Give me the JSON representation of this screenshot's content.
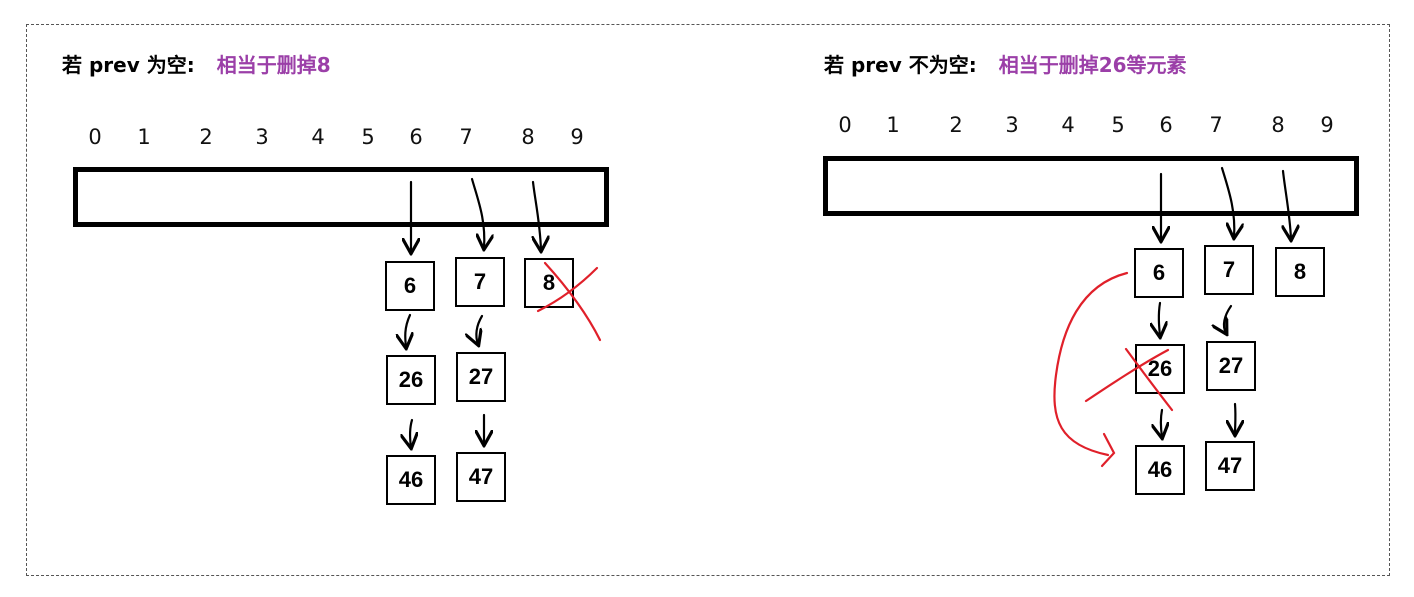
{
  "left_panel": {
    "heading": "若 prev 为空:",
    "note": "相当于删掉8",
    "indices": [
      "0",
      "1",
      "2",
      "3",
      "4",
      "5",
      "6",
      "7",
      "8",
      "9"
    ],
    "nodes": {
      "b6": "6",
      "b7": "7",
      "b8": "8",
      "b26": "26",
      "b27": "27",
      "b46": "46",
      "b47": "47"
    }
  },
  "right_panel": {
    "heading": "若 prev 不为空:",
    "note": "相当于删掉26等元素",
    "indices": [
      "0",
      "1",
      "2",
      "3",
      "4",
      "5",
      "6",
      "7",
      "8",
      "9"
    ],
    "nodes": {
      "b6": "6",
      "b7": "7",
      "b8": "8",
      "b26": "26",
      "b27": "27",
      "b46": "46",
      "b47": "47"
    }
  },
  "colors": {
    "accent": "#9b3fa8",
    "strike": "#e0202a",
    "ink": "#000000"
  }
}
